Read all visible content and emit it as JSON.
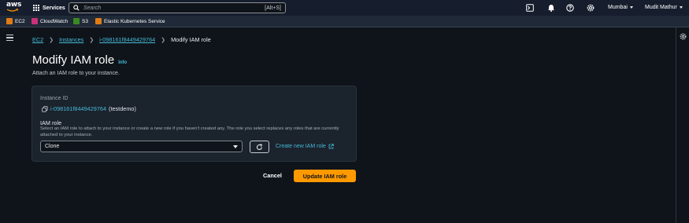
{
  "topnav": {
    "logo_text": "aws",
    "services_label": "Services",
    "search_placeholder": "Search",
    "search_shortcut": "[Alt+S]",
    "region": "Mumbai",
    "user": "Mudit Mathur",
    "icons": [
      "terminal-icon",
      "bell-icon",
      "help-icon",
      "settings-icon"
    ]
  },
  "favorites": [
    {
      "label": "EC2",
      "color": "#e07b16"
    },
    {
      "label": "CloudWatch",
      "color": "#c9327a"
    },
    {
      "label": "S3",
      "color": "#3a8a22"
    },
    {
      "label": "Elastic Kubernetes Service",
      "color": "#e07b16"
    }
  ],
  "breadcrumb": {
    "items": [
      "EC2",
      "Instances",
      "i-098161f8449429764"
    ],
    "current": "Modify IAM role"
  },
  "page": {
    "title": "Modify IAM role",
    "info": "Info",
    "description": "Attach an IAM role to your instance."
  },
  "form": {
    "instance_label": "Instance ID",
    "instance_id": "i-098161f8449429764",
    "instance_name": "(testdemo)",
    "role_label": "IAM role",
    "role_help": "Select an IAM role to attach to your instance or create a new role if you haven't created any. The role you select replaces any roles that are currently attached to your instance.",
    "role_value": "Clone",
    "create_link": "Create new IAM role"
  },
  "actions": {
    "cancel": "Cancel",
    "submit": "Update IAM role"
  },
  "colors": {
    "accent": "#ff9900",
    "link": "#44b9d6",
    "background": "#0f141a"
  }
}
